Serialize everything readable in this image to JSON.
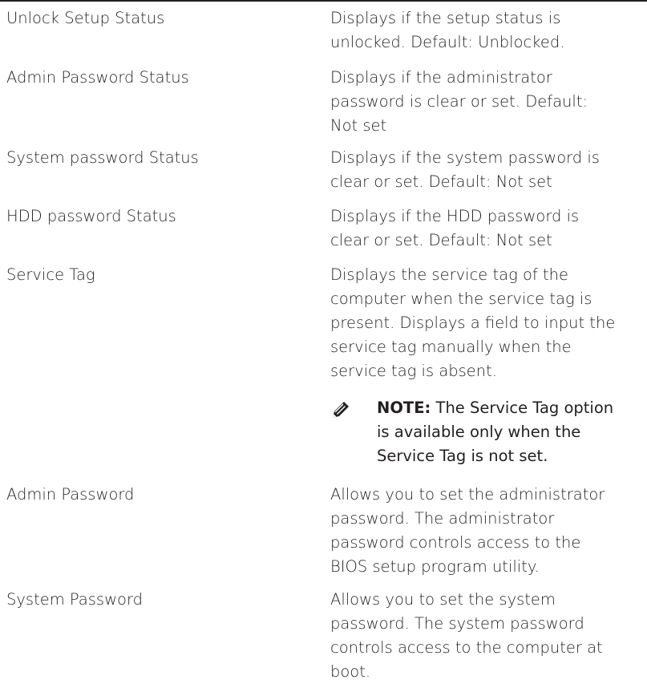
{
  "rows": [
    {
      "label": "Unlock Setup Status",
      "desc_lines": [
        "Displays if the setup status is",
        "unlocked. Default: Unblocked."
      ]
    },
    {
      "label": "Admin Password Status",
      "desc_lines": [
        "Displays if the administrator",
        "password is clear or set. Default:",
        "Not set"
      ]
    },
    {
      "label": "System password Status",
      "desc_lines": [
        "Displays if the system password is",
        "clear or set. Default: Not set"
      ]
    },
    {
      "label": "HDD password Status",
      "desc_lines": [
        "Displays if the HDD password is",
        "clear or set. Default: Not set"
      ]
    },
    {
      "label": "Service Tag",
      "desc_lines": [
        "Displays the service tag of the",
        "computer when the service tag is",
        "present. Displays a field to input the",
        "service tag manually when the",
        "service tag is absent."
      ]
    },
    {
      "label": "Admin Password",
      "desc_lines": [
        "Allows you to set the administrator",
        "password. The administrator",
        "password controls access to the",
        "BIOS setup program utility."
      ]
    },
    {
      "label": "System Password",
      "desc_lines": [
        "Allows you to set the system",
        "password. The system password",
        "controls access to the computer at",
        "boot."
      ]
    }
  ],
  "note": {
    "icon": "pencil-note-icon",
    "label": "NOTE:",
    "line1_rest": " The Service Tag option",
    "line2": "is available only when the",
    "line3": "Service Tag is not set."
  }
}
